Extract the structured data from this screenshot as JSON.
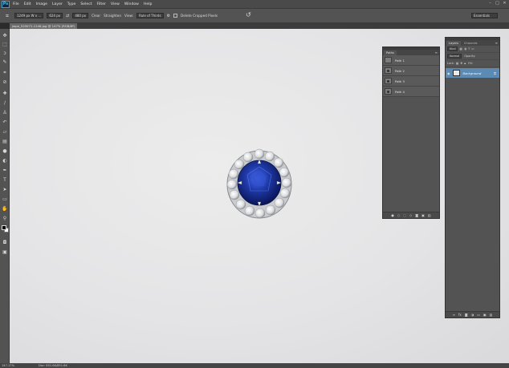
{
  "app": {
    "logo": "Ps",
    "menu": [
      "File",
      "Edit",
      "Image",
      "Layer",
      "Type",
      "Select",
      "Filter",
      "View",
      "Window",
      "Help"
    ],
    "window_controls": [
      "–",
      "□",
      "✕"
    ]
  },
  "options_bar": {
    "tool_icon": "crop-icon",
    "ratio_value": "1249 px W x ...",
    "width_value": "624 px",
    "swap_icon": "⇄",
    "height_value": "480 px",
    "clear_label": "Clear",
    "straighten_label": "Straighten",
    "view_label": "View:",
    "view_value": "Rule of Thirds",
    "settings_icon": "⚙",
    "delete_cropped_label": "Delete Cropped Pixels",
    "reset_icon": "↺",
    "workspace_value": "Essentials"
  },
  "document": {
    "tab_title": "jwpe_520071-1246.jpg @ 147% (RGB/8*)"
  },
  "tools": [
    "move-icon",
    "marquee-icon",
    "lasso-icon",
    "quick-select-icon",
    "crop-icon",
    "eyedropper-icon",
    "healing-icon",
    "brush-icon",
    "stamp-icon",
    "history-brush-icon",
    "eraser-icon",
    "gradient-icon",
    "blur-icon",
    "dodge-icon",
    "pen-icon",
    "type-icon",
    "path-select-icon",
    "shape-icon",
    "hand-icon",
    "zoom-icon"
  ],
  "status": {
    "zoom": "147.17%",
    "doc_size": "Doc: 851.6K/851.6K"
  },
  "paths_panel": {
    "tab_label": "Paths",
    "paths": [
      "Path 1",
      "Path 2",
      "Path 3",
      "Path 4"
    ]
  },
  "layers_panel": {
    "tabs": [
      "Layers",
      "Channels"
    ],
    "filter_label": "Kind",
    "blend_mode": "Normal",
    "opacity_label": "Opacity:",
    "lock_label": "Lock:",
    "fill_label": "Fill:",
    "layer_name": "Background"
  },
  "colors": {
    "ui_dark": "#535353",
    "selection": "#5b8ab5",
    "gem_blue": "#1f3aa8"
  }
}
